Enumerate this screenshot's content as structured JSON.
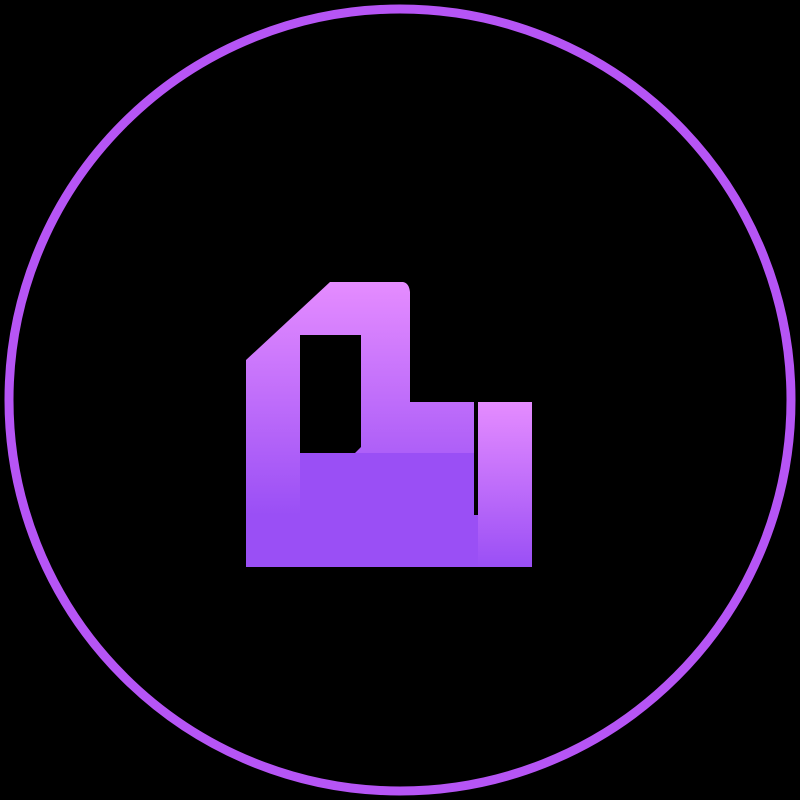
{
  "logo": {
    "icon": "l-monogram-icon",
    "ring_icon": "circle-ring-icon",
    "colors": {
      "background": "#000000",
      "ring": "#b655f5",
      "gradient_light": "#e58cff",
      "gradient_dark": "#9a4ff5"
    }
  }
}
